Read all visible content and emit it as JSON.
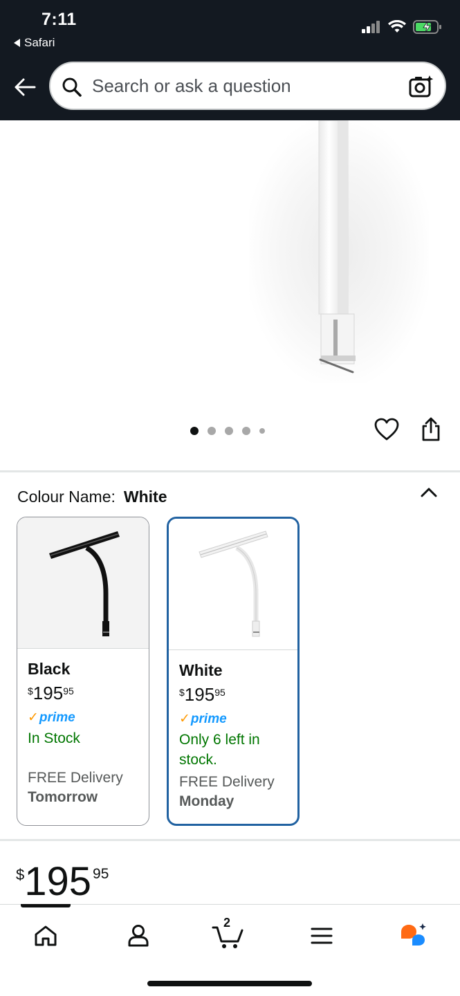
{
  "status_bar": {
    "time": "7:11",
    "back_app": "Safari"
  },
  "header": {
    "search_placeholder": "Search or ask a question"
  },
  "gallery": {
    "dot_count": 5,
    "active_dot": 1
  },
  "colour": {
    "label": "Colour Name:",
    "selected": "White",
    "options": [
      {
        "name": "Black",
        "price_symbol": "$",
        "price_whole": "195",
        "price_fraction": "95",
        "prime": "prime",
        "stock": "In Stock",
        "delivery_label": "FREE Delivery",
        "delivery_day": "Tomorrow"
      },
      {
        "name": "White",
        "price_symbol": "$",
        "price_whole": "195",
        "price_fraction": "95",
        "prime": "prime",
        "stock": "Only 6 left in stock.",
        "delivery_label": "FREE Delivery",
        "delivery_day": "Monday"
      }
    ]
  },
  "price": {
    "symbol": "$",
    "whole": "195",
    "fraction": "95"
  },
  "bottom_nav": {
    "cart_count": "2",
    "items": [
      "home-icon",
      "account-icon",
      "cart-icon",
      "menu-icon",
      "rufus-icon"
    ]
  },
  "colors": {
    "header_bg": "#131921",
    "prime_blue": "#1399ff",
    "prime_check": "#ff9900",
    "in_stock_green": "#007600",
    "selected_border": "#2162a1",
    "rufus_orange": "#ff6a14",
    "rufus_blue": "#1a8cff"
  }
}
